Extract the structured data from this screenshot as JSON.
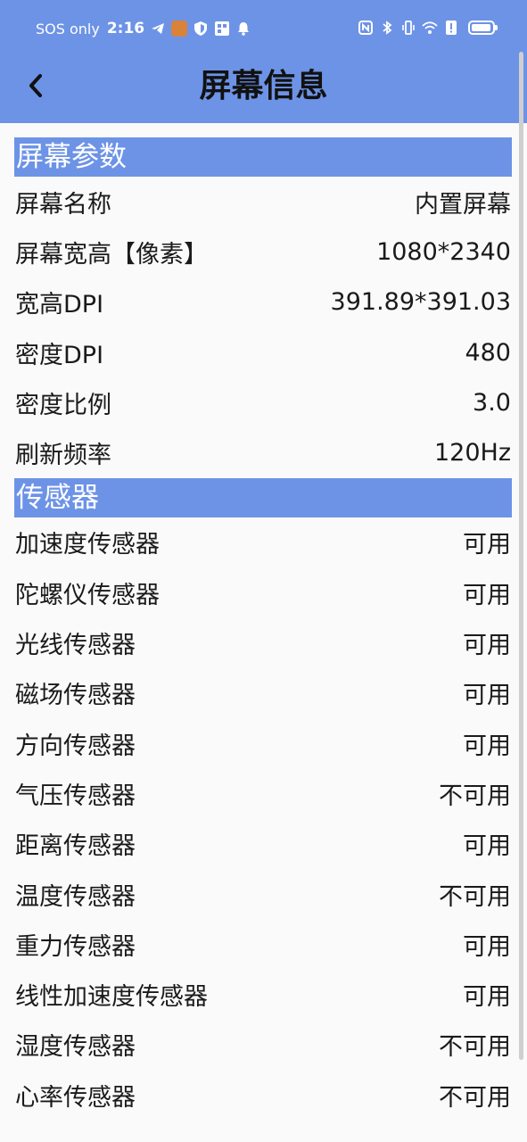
{
  "status_bar": {
    "carrier": "SOS only",
    "time": "2:16"
  },
  "header": {
    "title": "屏幕信息"
  },
  "sections": [
    {
      "title": "屏幕参数",
      "rows": [
        {
          "label": "屏幕名称",
          "value": "内置屏幕"
        },
        {
          "label": "屏幕宽高【像素】",
          "value": "1080*2340"
        },
        {
          "label": "宽高DPI",
          "value": "391.89*391.03"
        },
        {
          "label": "密度DPI",
          "value": "480"
        },
        {
          "label": "密度比例",
          "value": "3.0"
        },
        {
          "label": "刷新频率",
          "value": "120Hz"
        }
      ]
    },
    {
      "title": "传感器",
      "rows": [
        {
          "label": "加速度传感器",
          "value": "可用"
        },
        {
          "label": "陀螺仪传感器",
          "value": "可用"
        },
        {
          "label": "光线传感器",
          "value": "可用"
        },
        {
          "label": "磁场传感器",
          "value": "可用"
        },
        {
          "label": "方向传感器",
          "value": "可用"
        },
        {
          "label": "气压传感器",
          "value": "不可用"
        },
        {
          "label": "距离传感器",
          "value": "可用"
        },
        {
          "label": "温度传感器",
          "value": "不可用"
        },
        {
          "label": "重力传感器",
          "value": "可用"
        },
        {
          "label": "线性加速度传感器",
          "value": "可用"
        },
        {
          "label": "湿度传感器",
          "value": "不可用"
        },
        {
          "label": "心率传感器",
          "value": "不可用"
        }
      ]
    }
  ],
  "colors": {
    "accent": "#6d93e6",
    "background": "#fafafa"
  }
}
